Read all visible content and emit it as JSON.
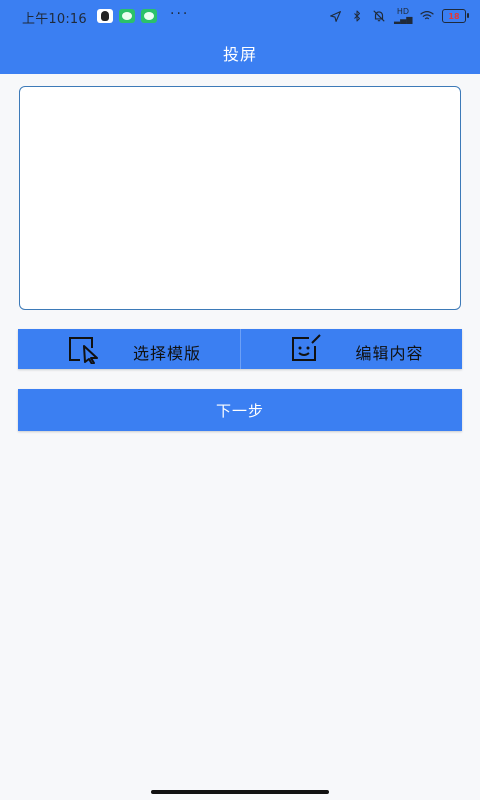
{
  "status_bar": {
    "time": "上午10:16",
    "more": "···",
    "signal_label": "HD",
    "battery_level": "18"
  },
  "header": {
    "title": "投屏"
  },
  "actions": {
    "select_template_label": "选择模版",
    "edit_content_label": "编辑内容"
  },
  "next_button_label": "下一步",
  "colors": {
    "primary": "#3b7ff2",
    "text_dark": "#111111",
    "text_on_primary": "#ffffff",
    "border_box": "#3d7ab8",
    "background": "#f7f8fa"
  },
  "icons": {
    "status_left": [
      "qq-icon",
      "wechat-icon",
      "wechat-icon"
    ],
    "status_right": [
      "navigation-icon",
      "bluetooth-icon",
      "mute-icon",
      "signal-icon",
      "wifi-icon",
      "battery-icon"
    ],
    "actions": [
      "select-template-icon",
      "edit-content-icon"
    ]
  }
}
